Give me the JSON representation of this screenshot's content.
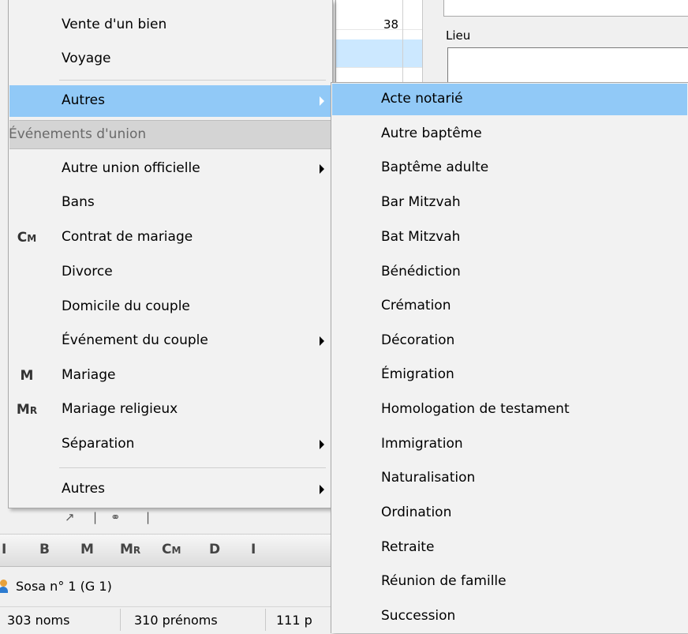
{
  "background": {
    "list_number": "38",
    "lieu_label": "Lieu",
    "toolbar_buttons": [
      {
        "main": "I",
        "small": ""
      },
      {
        "main": "B",
        "small": ""
      },
      {
        "main": "M",
        "small": ""
      },
      {
        "main": "M",
        "small": "R"
      },
      {
        "main": "C",
        "small": "M"
      },
      {
        "main": "D",
        "small": ""
      },
      {
        "main": "I",
        "small": ""
      }
    ],
    "sosa_text": "Sosa n° 1 (G 1)",
    "status": {
      "noms": "303 noms",
      "prenoms": "310 prénoms",
      "third": "111 p"
    }
  },
  "left_menu": {
    "top_items": [
      "Vente d'un bien",
      "Voyage"
    ],
    "autres_label": "Autres",
    "union_section_label": "Événements d'union",
    "union_items": [
      {
        "label": "Autre union officielle",
        "icon": "",
        "icon_small": "",
        "submenu": true
      },
      {
        "label": "Bans",
        "icon": "",
        "icon_small": "",
        "submenu": false
      },
      {
        "label": "Contrat de mariage",
        "icon": "C",
        "icon_small": "M",
        "submenu": false
      },
      {
        "label": "Divorce",
        "icon": "",
        "icon_small": "",
        "submenu": false
      },
      {
        "label": "Domicile du couple",
        "icon": "",
        "icon_small": "",
        "submenu": false
      },
      {
        "label": "Événement du couple",
        "icon": "",
        "icon_small": "",
        "submenu": true
      },
      {
        "label": "Mariage",
        "icon": "M",
        "icon_small": "",
        "submenu": false
      },
      {
        "label": "Mariage religieux",
        "icon": "M",
        "icon_small": "R",
        "submenu": false
      },
      {
        "label": "Séparation",
        "icon": "",
        "icon_small": "",
        "submenu": true
      }
    ],
    "bottom_autres_label": "Autres"
  },
  "right_menu": {
    "items": [
      "Acte notarié",
      "Autre baptême",
      "Baptême adulte",
      "Bar Mitzvah",
      "Bat Mitzvah",
      "Bénédiction",
      "Crémation",
      "Décoration",
      "Émigration",
      "Homologation de testament",
      "Immigration",
      "Naturalisation",
      "Ordination",
      "Retraite",
      "Réunion de famille",
      "Succession"
    ]
  },
  "colors": {
    "highlight": "#91c9f7",
    "menu_bg": "#f2f2f2",
    "section_bg": "#d4d4d4"
  }
}
